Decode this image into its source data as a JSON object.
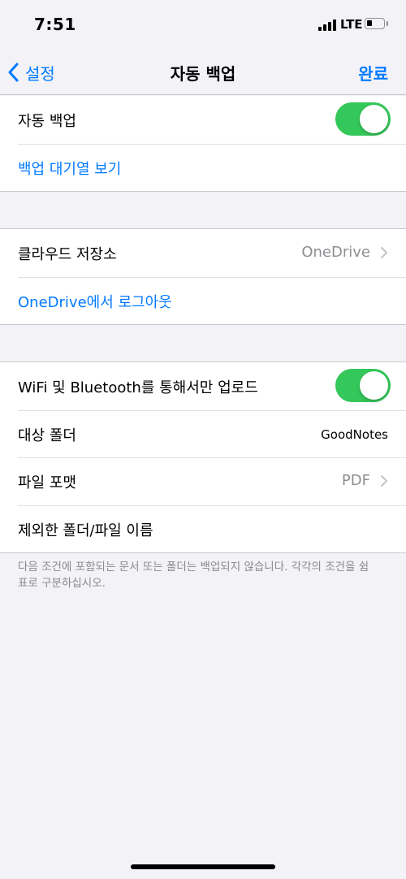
{
  "status_bar": {
    "time": "7:51",
    "network": "LTE",
    "battery_level": 0.35
  },
  "nav": {
    "back_label": "설정",
    "title": "자동 백업",
    "done_label": "완료",
    "accent_color": "#007aff"
  },
  "group1": {
    "auto_backup_label": "자동 백업",
    "auto_backup_on": true,
    "view_queue_label": "백업 대기열 보기"
  },
  "group2": {
    "cloud_storage_label": "클라우드 저장소",
    "cloud_storage_value": "OneDrive",
    "logout_label": "OneDrive에서 로그아웃"
  },
  "group3": {
    "wifi_only_label": "WiFi 및 Bluetooth를 통해서만 업로드",
    "wifi_only_on": true,
    "target_folder_label": "대상 폴더",
    "target_folder_value": "GoodNotes",
    "file_format_label": "파일 포맷",
    "file_format_value": "PDF",
    "excluded_label": "제외한 폴더/파일 이름"
  },
  "footer": {
    "note": "다음 조건에 포함되는 문서 또는 폴더는 백업되지 않습니다. 각각의 조건을 쉼표로 구분하십시오."
  },
  "colors": {
    "toggle_on": "#34c759",
    "background": "#f2f2f7"
  }
}
